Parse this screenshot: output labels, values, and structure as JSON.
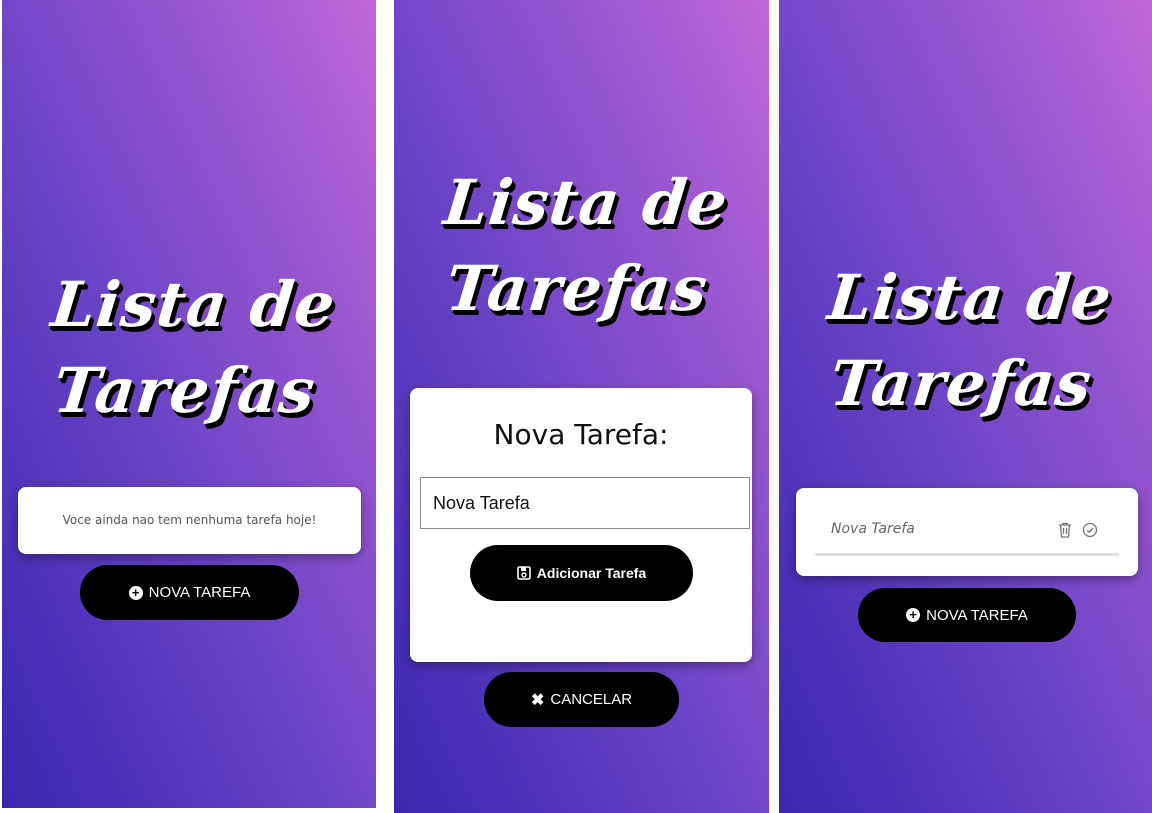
{
  "app": {
    "title_line1": "Lista de",
    "title_line2": "Tarefas"
  },
  "screen_empty": {
    "empty_message": "Voce ainda nao tem nenhuma tarefa hoje!",
    "new_task_label": "NOVA TAREFA"
  },
  "screen_modal": {
    "modal_title": "Nova Tarefa:",
    "task_input_value": "Nova Tarefa",
    "add_button_label": "Adicionar Tarefa",
    "cancel_button_label": "CANCELAR"
  },
  "screen_list": {
    "tasks": [
      {
        "text": "Nova Tarefa"
      }
    ],
    "new_task_label": "NOVA TAREFA"
  },
  "icons": {
    "new_task": "plus-circle-icon",
    "save": "floppy-disk-icon",
    "cancel": "x-icon",
    "delete": "trash-icon",
    "complete": "check-circle-icon"
  },
  "colors": {
    "gradient_start": "#3b26b0",
    "gradient_end": "#c166d8",
    "button": "#000000",
    "card": "#ffffff"
  }
}
